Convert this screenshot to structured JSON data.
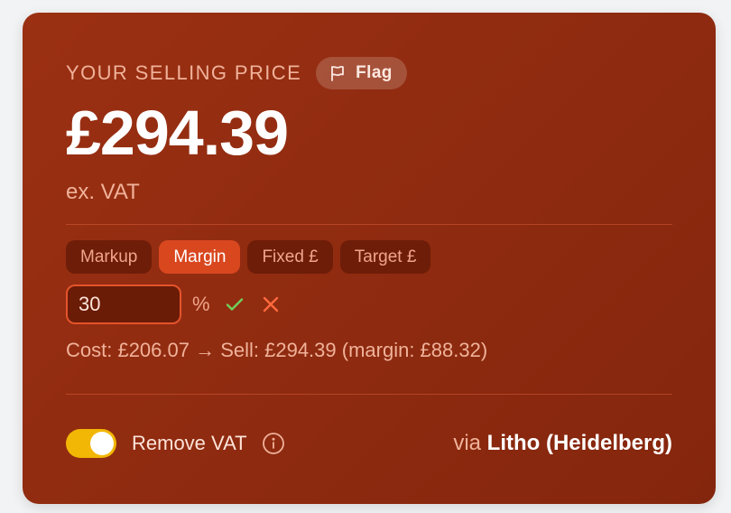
{
  "header": {
    "eyebrow": "YOUR SELLING PRICE",
    "flag_label": "Flag",
    "flag_icon": "flag-icon"
  },
  "price": {
    "amount": "£294.39",
    "note": "ex. VAT"
  },
  "pricing_modes": {
    "tabs": [
      {
        "label": "Markup",
        "active": false
      },
      {
        "label": "Margin",
        "active": true
      },
      {
        "label": "Fixed £",
        "active": false
      },
      {
        "label": "Target £",
        "active": false
      }
    ],
    "input_value": "30",
    "unit": "%",
    "confirm_icon": "check-icon",
    "cancel_icon": "close-icon"
  },
  "summary": "Cost: £206.07 → Sell: £294.39 (margin: £88.32)",
  "footer": {
    "toggle_label": "Remove VAT",
    "toggle_on": true,
    "info_icon": "info-icon",
    "via_prefix": "via",
    "via_method": "Litho (Heidelberg)"
  },
  "colors": {
    "card_bg": "#922c10",
    "accent": "#d9471f",
    "toggle": "#f2b705",
    "confirm": "#6fcf5a",
    "cancel": "#ff6a3d"
  }
}
